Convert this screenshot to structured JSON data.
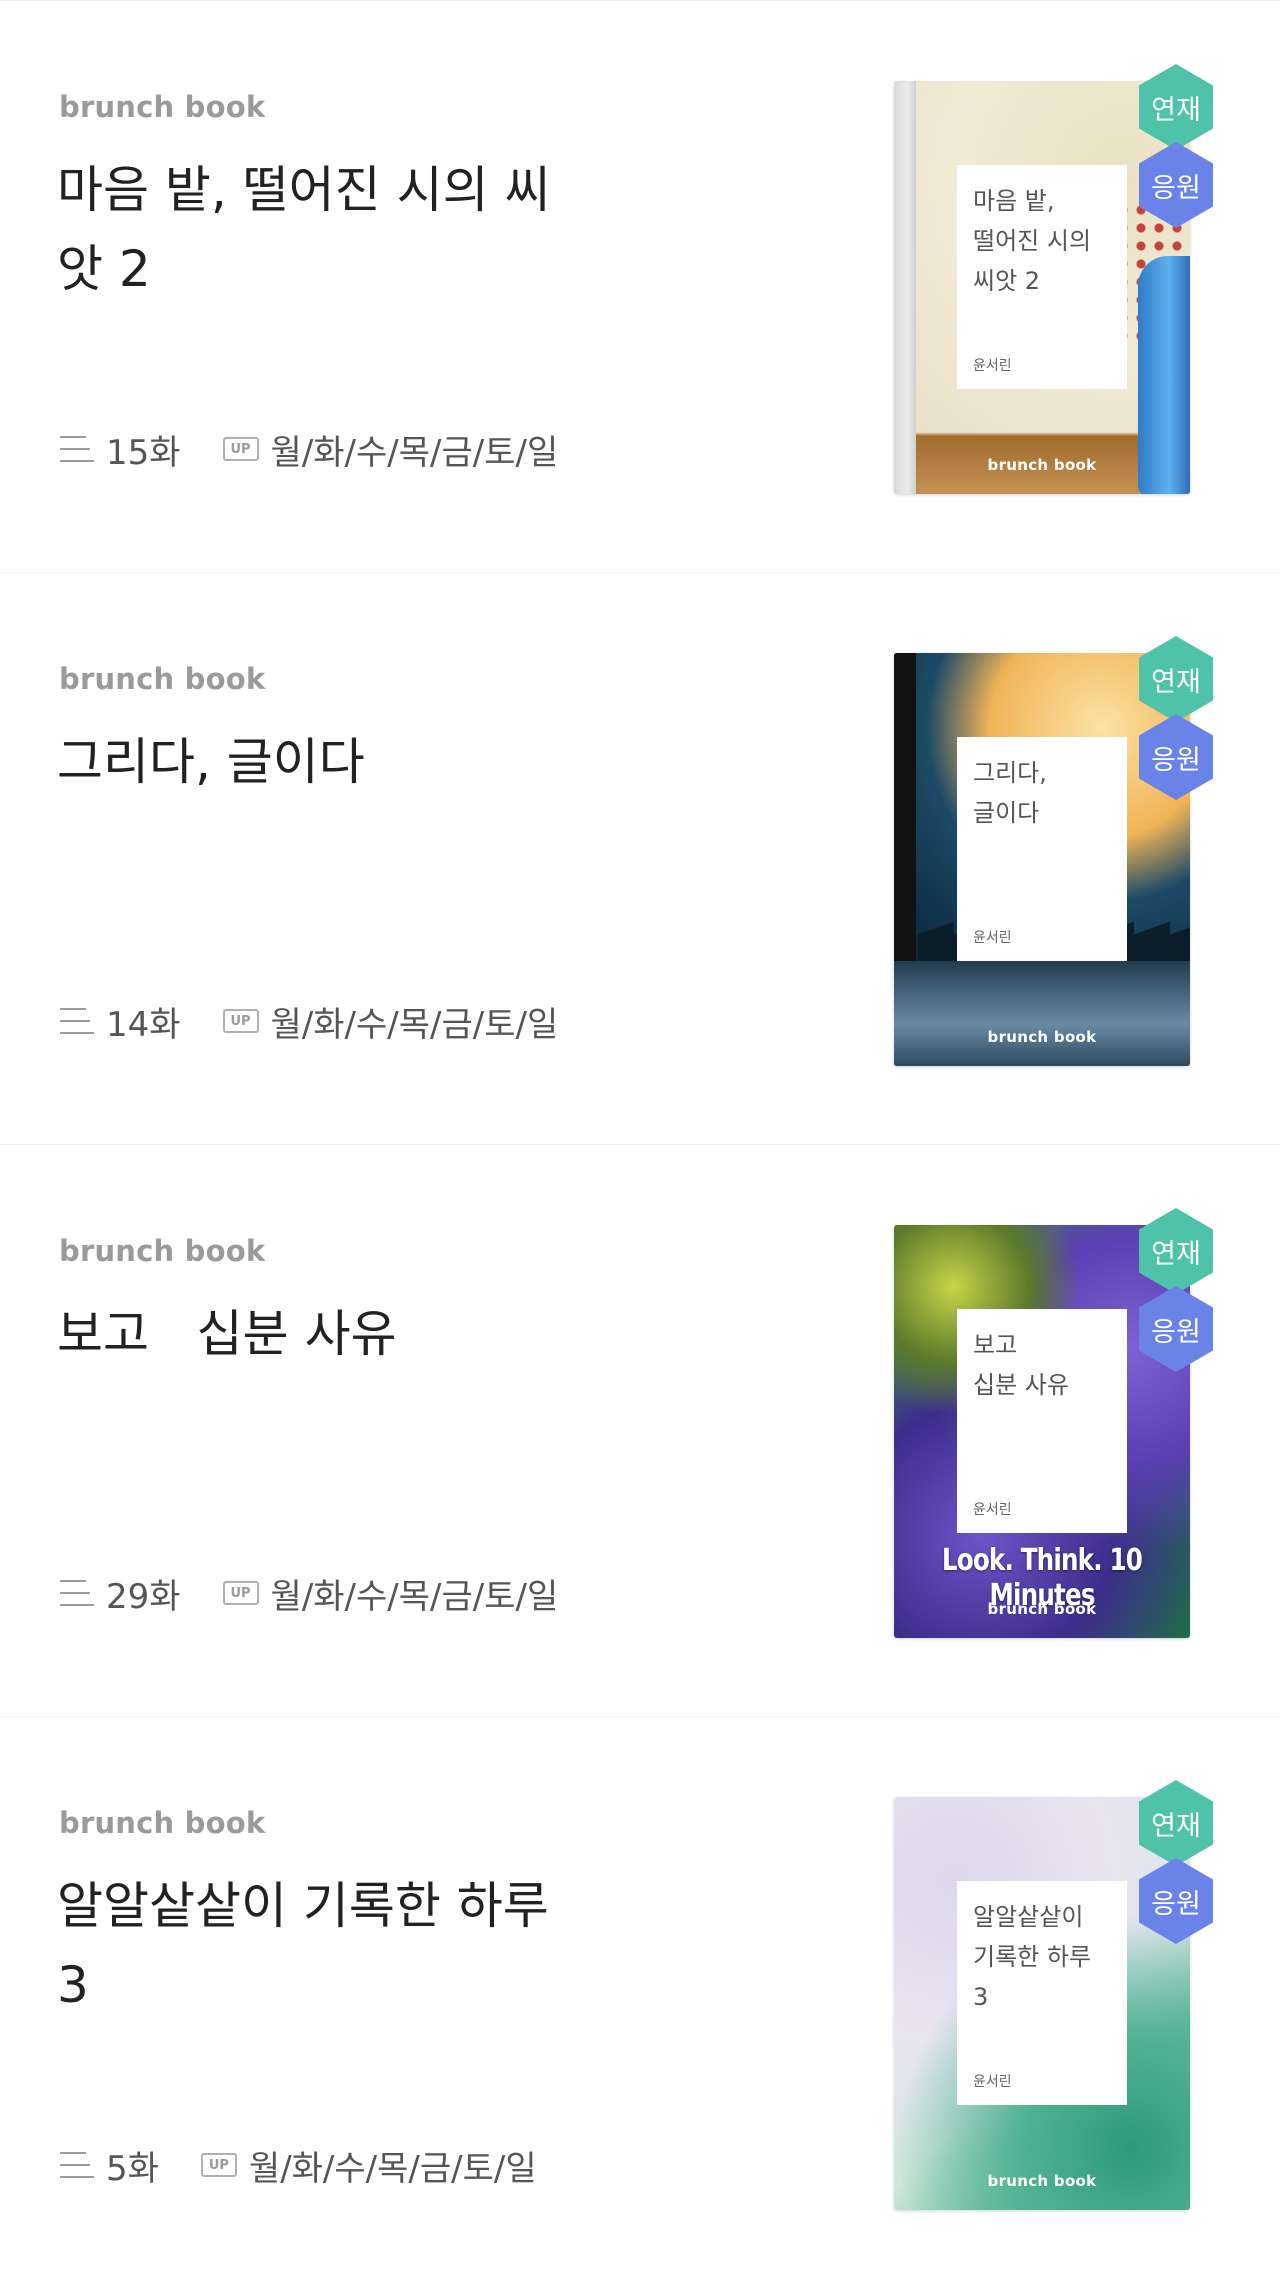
{
  "books": [
    {
      "label": "brunch book",
      "title": "마음 밭, 떨어진 시의 씨\n앗 2",
      "episodes": "15화",
      "up_badge": "UP",
      "schedule": "월/화/수/목/금/토/일",
      "cover": {
        "title": "마음 밭,\n떨어진 시의\n씨앗 2",
        "author": "윤서린",
        "brand": "brunch book",
        "subtitle": ""
      },
      "badges": {
        "serial": "연재",
        "support": "응원"
      }
    },
    {
      "label": "brunch book",
      "title": "그리다, 글이다",
      "episodes": "14화",
      "up_badge": "UP",
      "schedule": "월/화/수/목/금/토/일",
      "cover": {
        "title": "그리다,\n글이다",
        "author": "윤서린",
        "brand": "brunch book",
        "subtitle": ""
      },
      "badges": {
        "serial": "연재",
        "support": "응원"
      }
    },
    {
      "label": "brunch book",
      "title": "보고   십분 사유",
      "episodes": "29화",
      "up_badge": "UP",
      "schedule": "월/화/수/목/금/토/일",
      "cover": {
        "title": "보고\n십분 사유",
        "author": "윤서린",
        "brand": "brunch book",
        "subtitle": "Look. Think. 10 Minutes"
      },
      "badges": {
        "serial": "연재",
        "support": "응원"
      }
    },
    {
      "label": "brunch book",
      "title": "알알샅샅이 기록한 하루\n3",
      "episodes": "5화",
      "up_badge": "UP",
      "schedule": "월/화/수/목/금/토/일",
      "cover": {
        "title": "알알샅샅이\n기록한 하루\n3",
        "author": "윤서린",
        "brand": "brunch book",
        "subtitle": ""
      },
      "badges": {
        "serial": "연재",
        "support": "응원"
      }
    }
  ],
  "colors": {
    "serial_badge": "#4fc3aa",
    "support_badge": "#6a83e8",
    "label_gray": "#9a9a9a",
    "title_text": "#222222"
  },
  "icons": {
    "episode_list": "list-lines-icon",
    "update": "up-badge-icon"
  }
}
